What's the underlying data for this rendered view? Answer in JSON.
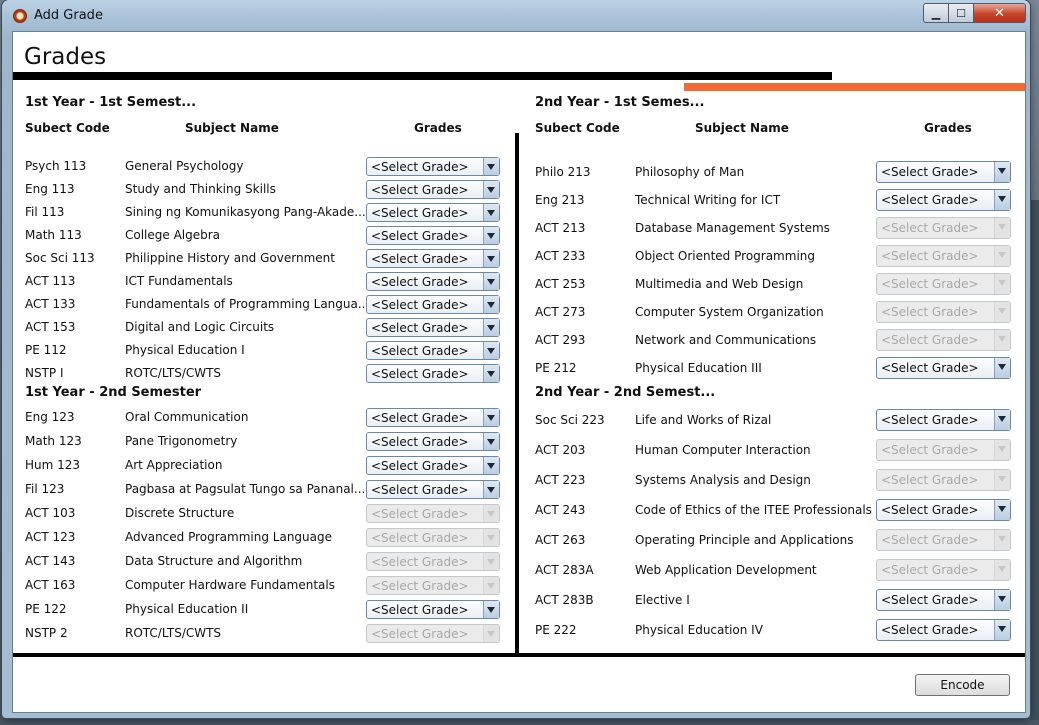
{
  "window": {
    "title": "Add Grade",
    "min_label": "▁",
    "max_label": "☐",
    "close_label": "✕"
  },
  "header": {
    "title": "Grades"
  },
  "columns": {
    "code": "Subect Code",
    "name": "Subject Name",
    "grades": "Grades"
  },
  "select_placeholder": "<Select Grade>",
  "encode_label": "Encode",
  "sections": [
    {
      "title": "1st Year - 1st Semest...",
      "rows": [
        {
          "code": "Psych 113",
          "name": "General Psychology",
          "grade": "<Select Grade>",
          "enabled": true
        },
        {
          "code": "Eng 113",
          "name": "Study and Thinking Skills",
          "grade": "<Select Grade>",
          "enabled": true
        },
        {
          "code": "Fil 113",
          "name": "Sining ng Komunikasyong Pang-Akade...",
          "grade": "<Select Grade>",
          "enabled": true
        },
        {
          "code": "Math 113",
          "name": "College Algebra",
          "grade": "<Select Grade>",
          "enabled": true
        },
        {
          "code": "Soc Sci 113",
          "name": "Philippine History and Government",
          "grade": "<Select Grade>",
          "enabled": true
        },
        {
          "code": "ACT 113",
          "name": "ICT Fundamentals",
          "grade": "<Select Grade>",
          "enabled": true
        },
        {
          "code": "ACT 133",
          "name": "Fundamentals of Programming Langua...",
          "grade": "<Select Grade>",
          "enabled": true
        },
        {
          "code": "ACT 153",
          "name": "Digital and Logic Circuits",
          "grade": "<Select Grade>",
          "enabled": true
        },
        {
          "code": "PE 112",
          "name": "Physical Education I",
          "grade": "<Select Grade>",
          "enabled": true
        },
        {
          "code": "NSTP I",
          "name": "ROTC/LTS/CWTS",
          "grade": "<Select Grade>",
          "enabled": true
        }
      ]
    },
    {
      "title": "1st Year - 2nd Semester",
      "rows": [
        {
          "code": "Eng 123",
          "name": "Oral Communication",
          "grade": "<Select Grade>",
          "enabled": true
        },
        {
          "code": "Math 123",
          "name": "Pane Trigonometry",
          "grade": "<Select Grade>",
          "enabled": true
        },
        {
          "code": "Hum 123",
          "name": "Art Appreciation",
          "grade": "<Select Grade>",
          "enabled": true
        },
        {
          "code": "Fil 123",
          "name": "Pagbasa at Pagsulat Tungo sa Pananal...",
          "grade": "<Select Grade>",
          "enabled": true
        },
        {
          "code": "ACT 103",
          "name": "Discrete Structure",
          "grade": "<Select Grade>",
          "enabled": false
        },
        {
          "code": "ACT 123",
          "name": "Advanced Programming Language",
          "grade": "<Select Grade>",
          "enabled": false
        },
        {
          "code": "ACT 143",
          "name": "Data Structure and Algorithm",
          "grade": "<Select Grade>",
          "enabled": false
        },
        {
          "code": "ACT 163",
          "name": "Computer Hardware Fundamentals",
          "grade": "<Select Grade>",
          "enabled": false
        },
        {
          "code": "PE 122",
          "name": "Physical Education II",
          "grade": "<Select Grade>",
          "enabled": true
        },
        {
          "code": "NSTP 2",
          "name": "ROTC/LTS/CWTS",
          "grade": "<Select Grade>",
          "enabled": false
        }
      ]
    },
    {
      "title": "2nd Year - 1st Semes...",
      "rows": [
        {
          "code": "Philo 213",
          "name": "Philosophy of Man",
          "grade": "<Select Grade>",
          "enabled": true
        },
        {
          "code": "Eng 213",
          "name": "Technical Writing for ICT",
          "grade": "<Select Grade>",
          "enabled": true
        },
        {
          "code": "ACT 213",
          "name": "Database Management Systems",
          "grade": "<Select Grade>",
          "enabled": false
        },
        {
          "code": "ACT 233",
          "name": "Object Oriented Programming",
          "grade": "<Select Grade>",
          "enabled": false
        },
        {
          "code": "ACT 253",
          "name": "Multimedia and Web Design",
          "grade": "<Select Grade>",
          "enabled": false
        },
        {
          "code": "ACT 273",
          "name": "Computer System Organization",
          "grade": "<Select Grade>",
          "enabled": false
        },
        {
          "code": "ACT 293",
          "name": "Network and Communications",
          "grade": "<Select Grade>",
          "enabled": false
        },
        {
          "code": "PE 212",
          "name": "Physical Education III",
          "grade": "<Select Grade>",
          "enabled": true
        }
      ]
    },
    {
      "title": "2nd Year - 2nd Semest...",
      "rows": [
        {
          "code": "Soc Sci 223",
          "name": "Life and Works of Rizal",
          "grade": "<Select Grade>",
          "enabled": true
        },
        {
          "code": "ACT 203",
          "name": "Human Computer Interaction",
          "grade": "<Select Grade>",
          "enabled": false
        },
        {
          "code": "ACT 223",
          "name": "Systems Analysis and Design",
          "grade": "<Select Grade>",
          "enabled": false
        },
        {
          "code": "ACT 243",
          "name": "Code of Ethics of the ITEE Professionals",
          "grade": "<Select Grade>",
          "enabled": true
        },
        {
          "code": "ACT 263",
          "name": "Operating Principle and Applications",
          "grade": "<Select Grade>",
          "enabled": false
        },
        {
          "code": "ACT 283A",
          "name": "Web Application Development",
          "grade": "<Select Grade>",
          "enabled": false
        },
        {
          "code": "ACT 283B",
          "name": "Elective I",
          "grade": "<Select Grade>",
          "enabled": true
        },
        {
          "code": "PE 222",
          "name": "Physical Education IV",
          "grade": "<Select Grade>",
          "enabled": true
        }
      ]
    }
  ]
}
